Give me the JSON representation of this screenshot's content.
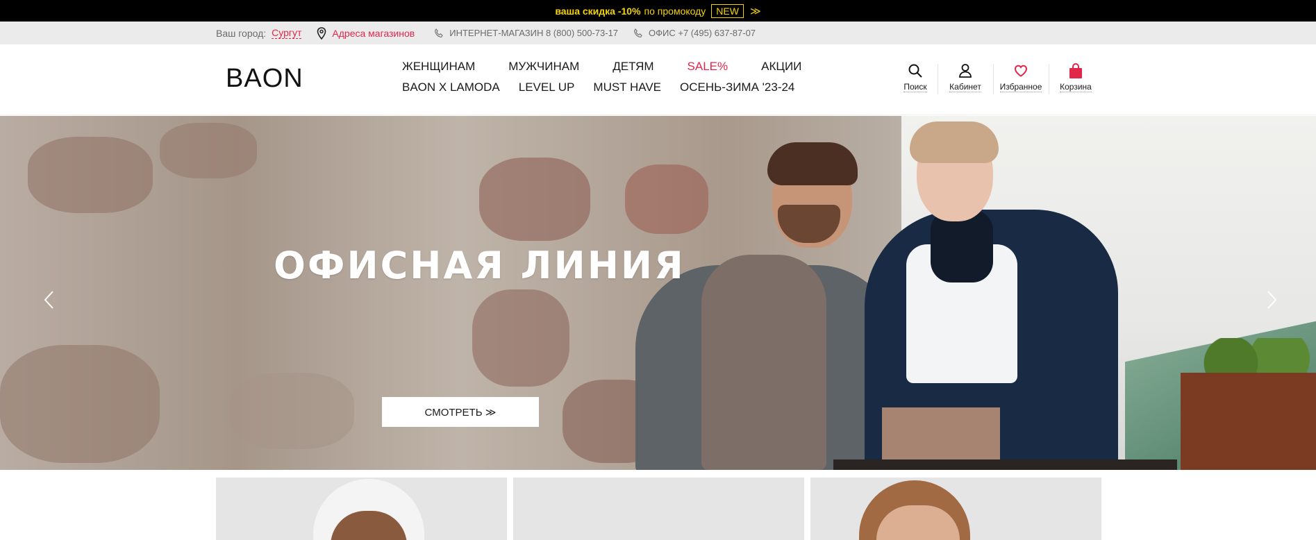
{
  "promo": {
    "text_bold": "ваша скидка -10%",
    "text": "по промокоду",
    "code": "NEW",
    "arrow": "≫"
  },
  "infobar": {
    "city_label": "Ваш город:",
    "city": "Сургут",
    "stores": "Адреса магазинов",
    "online_shop": "ИНТЕРНЕТ-МАГАЗИН 8 (800) 500-73-17",
    "office": "ОФИС +7 (495) 637-87-07"
  },
  "header": {
    "logo": "BAON",
    "nav_row1": [
      "ЖЕНЩИНАМ",
      "МУЖЧИНАМ",
      "ДЕТЯМ",
      "SALE%",
      "АКЦИИ"
    ],
    "nav_row2": [
      "BAON X LAMODA",
      "LEVEL UP",
      "MUST HAVE",
      "ОСЕНЬ-ЗИМА '23-24"
    ],
    "tools": {
      "search": "Поиск",
      "account": "Кабинет",
      "favorites": "Избранное",
      "cart": "Корзина"
    }
  },
  "hero": {
    "title": "ОФИСНАЯ ЛИНИЯ",
    "button": "СМОТРЕТЬ ≫"
  },
  "colors": {
    "accent": "#e2264a",
    "promo_text": "#f5d400",
    "promo_bg": "#000000",
    "infobar_bg": "#ebebeb"
  }
}
